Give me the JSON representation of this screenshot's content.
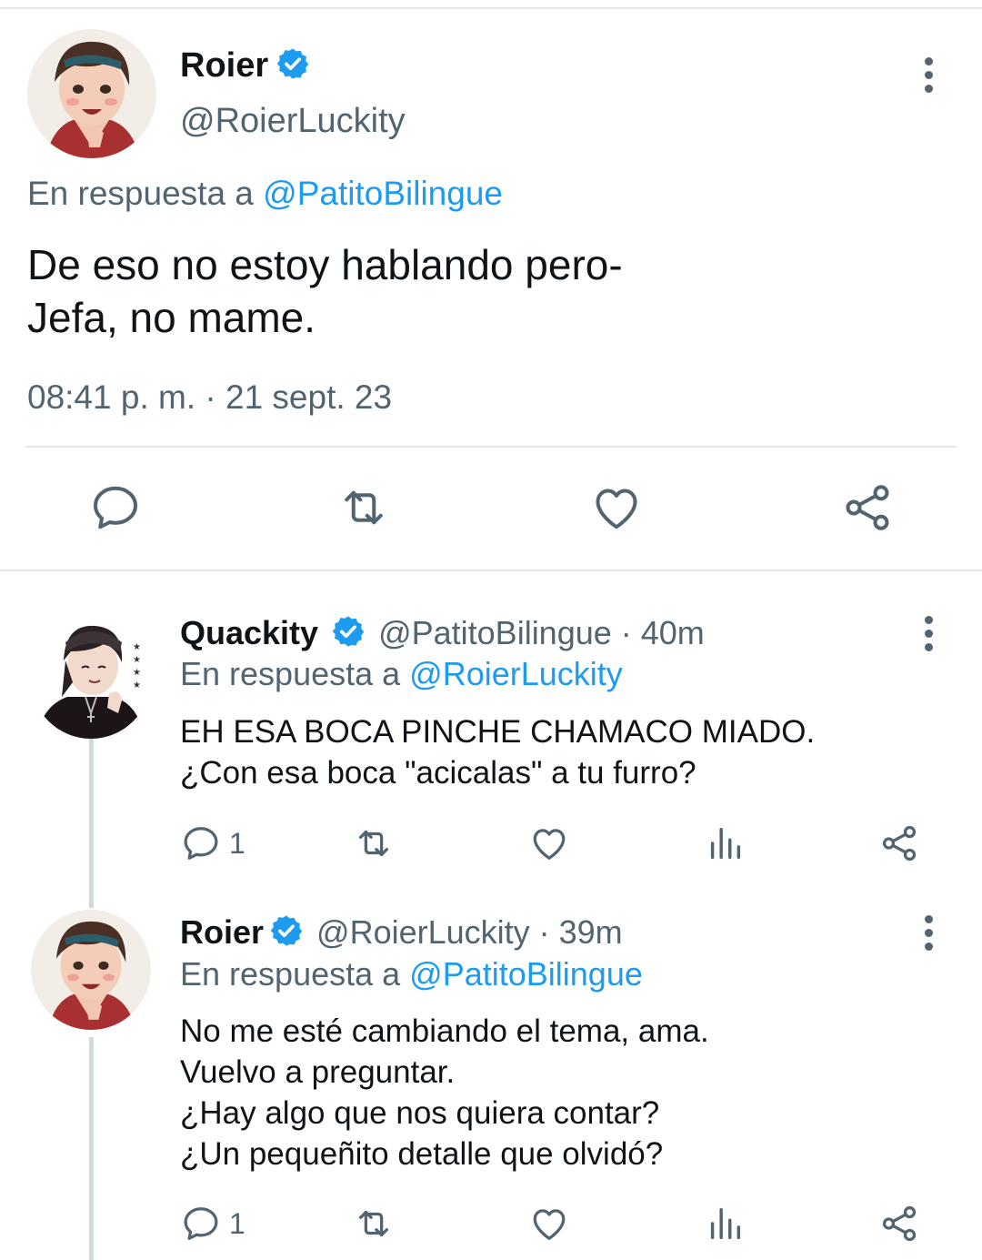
{
  "main_tweet": {
    "name": "Roier",
    "handle": "@RoierLuckity",
    "reply_prefix": "En respuesta a",
    "reply_to": "@PatitoBilingue",
    "text_line1": "De eso no estoy hablando pero-",
    "text_line2": "Jefa, no mame.",
    "timestamp": "08:41 p. m. · 21 sept. 23"
  },
  "replies": [
    {
      "name": "Quackity",
      "handle": "@PatitoBilingue · 40m",
      "reply_prefix": "En respuesta a",
      "reply_to": "@RoierLuckity",
      "text_lines": [
        "EH ESA BOCA PINCHE CHAMACO MIADO.",
        "¿Con esa boca \"acicalas\" a tu furro?"
      ],
      "reply_count": "1"
    },
    {
      "name": "Roier",
      "handle": "@RoierLuckity · 39m",
      "reply_prefix": "En respuesta a",
      "reply_to": "@PatitoBilingue",
      "text_lines": [
        "No me esté cambiando el tema, ama.",
        "Vuelvo a preguntar.",
        "¿Hay algo que nos quiera contar?",
        "¿Un pequeñito detalle que olvidó?"
      ],
      "reply_count": "1"
    }
  ],
  "colors": {
    "accent": "#1d9bf0",
    "secondary_text": "#536471",
    "primary_text": "#0f1419",
    "divider": "#e4e7ea",
    "thread_line": "#cfd9de"
  },
  "icons": [
    "verified-badge-icon",
    "more-options-icon",
    "reply-icon",
    "retweet-icon",
    "like-icon",
    "views-icon",
    "share-icon"
  ]
}
